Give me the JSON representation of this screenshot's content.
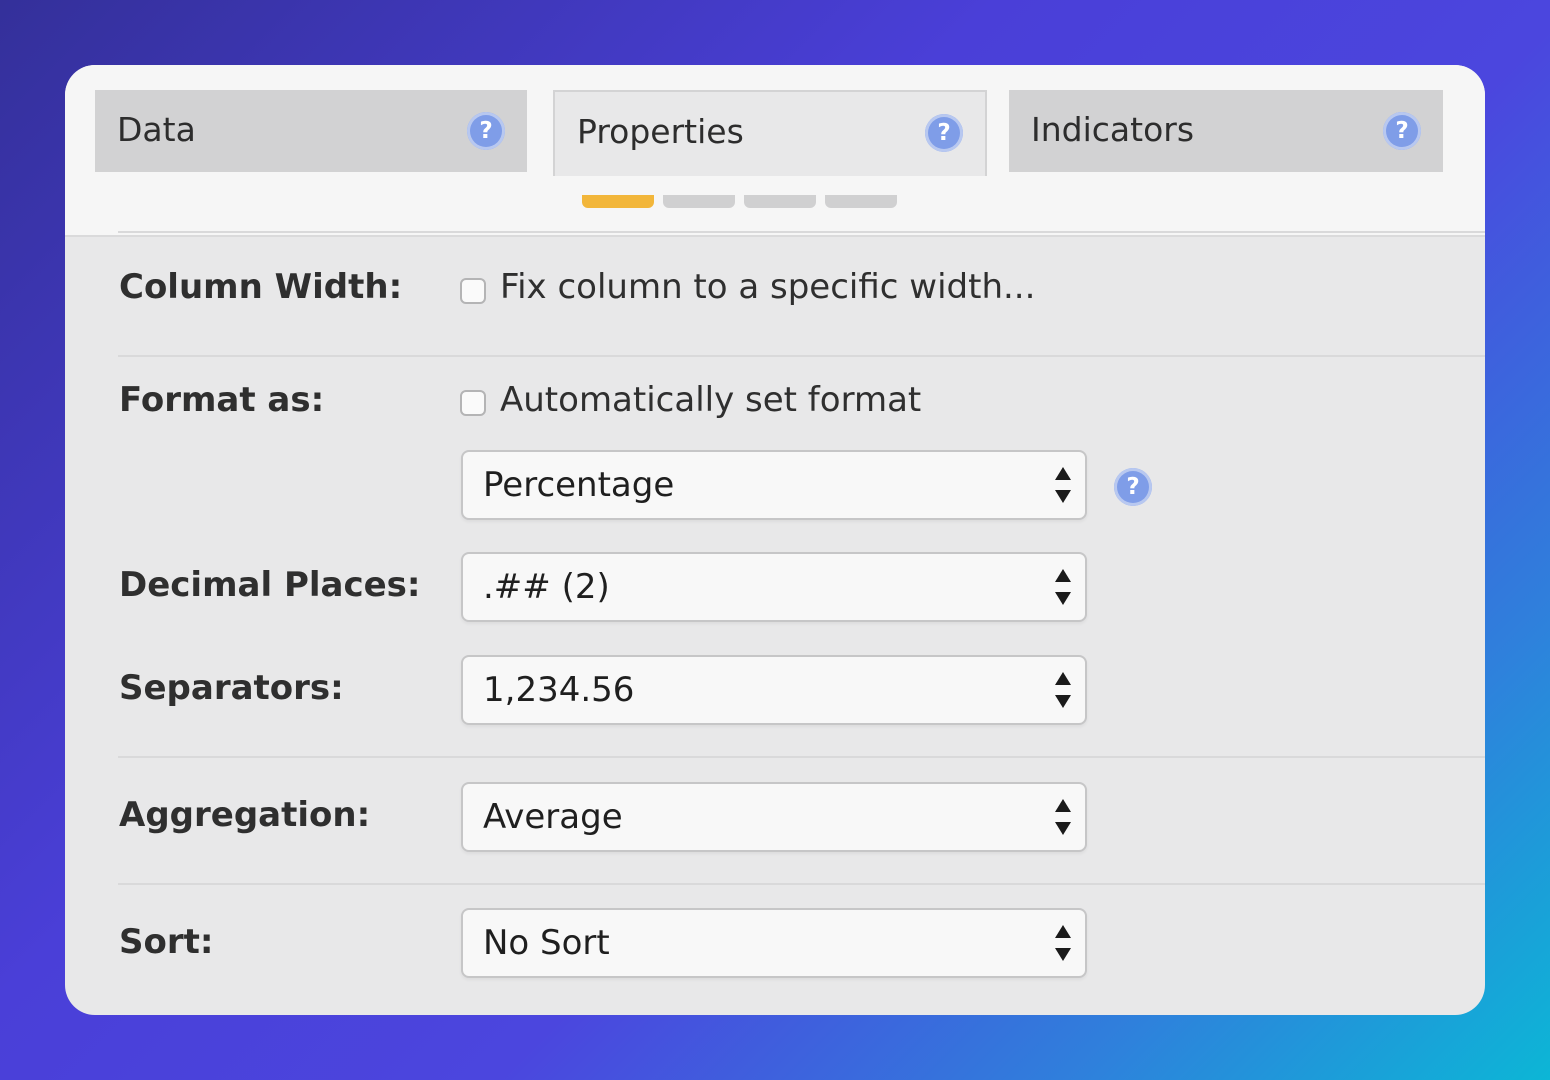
{
  "tabs": [
    {
      "label": "Data",
      "help_icon": "help-icon",
      "active": false
    },
    {
      "label": "Properties",
      "help_icon": "help-icon",
      "active": true
    },
    {
      "label": "Indicators",
      "help_icon": "help-icon",
      "active": false
    }
  ],
  "help_symbol": "?",
  "column_width": {
    "label": "Column Width:",
    "checkbox_label": "Fix column to a specific width...",
    "checked": false
  },
  "format_as": {
    "label": "Format as:",
    "checkbox_label": "Automatically set format",
    "checked": false,
    "select_value": "Percentage"
  },
  "decimal_places": {
    "label": "Decimal Places:",
    "select_value": ".## (2)"
  },
  "separators": {
    "label": "Separators:",
    "select_value": "1,234.56"
  },
  "aggregation": {
    "label": "Aggregation:",
    "select_value": "Average"
  },
  "sort": {
    "label": "Sort:",
    "select_value": "No Sort"
  },
  "colors": {
    "accent_step": "#f2b63a",
    "help_icon": "#7f9de8"
  }
}
